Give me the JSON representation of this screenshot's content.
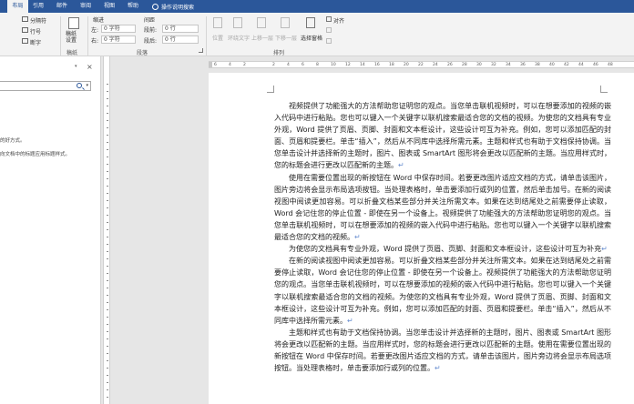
{
  "ribbon_tabs": [
    "布局",
    "引用",
    "邮件",
    "审阅",
    "视图",
    "帮助"
  ],
  "active_tab_index": 0,
  "tell_me": "操作说明搜索",
  "ribbon": {
    "breaks_label": "分隔符",
    "line_numbers_label": "行号",
    "hyphenation_label": "断字",
    "draft_label": "稿纸\n设置",
    "draft_group": "稿纸",
    "indent_label": "缩进",
    "spacing_label": "间距",
    "indent_left_label": "左:",
    "indent_left_value": "0 字符",
    "indent_right_label": "右:",
    "indent_right_value": "0 字符",
    "spacing_before_label": "段前:",
    "spacing_before_value": "0 行",
    "spacing_after_label": "段后:",
    "spacing_after_value": "0 行",
    "paragraph_group": "段落",
    "position_label": "位置",
    "wrap_label": "环绕文字",
    "forward_label": "上移一层",
    "backward_label": "下移一层",
    "selection_pane_label": "选择窗格",
    "align_label": "对齐",
    "arrange_group": "排列"
  },
  "nav": {
    "close": "×",
    "dropdown": "▾",
    "search_placeholder": "",
    "text1": "的好方式。",
    "text2": "向文档中的标题应用标题样式。"
  },
  "ruler_labels": [
    "6",
    "4",
    "2",
    "",
    "2",
    "4",
    "6",
    "8",
    "10",
    "12",
    "14",
    "16",
    "18",
    "20",
    "22",
    "24",
    "26",
    "28",
    "30",
    "32",
    "34",
    "36",
    "38",
    "40",
    "42",
    "44",
    "46",
    "48"
  ],
  "paragraphs": [
    "视频提供了功能强大的方法帮助您证明您的观点。当您单击联机视频时，可以在想要添加的视频的嵌入代码中进行粘贴。您也可以键入一个关键字以联机搜索最适合您的文档的视频。为使您的文档具有专业外观，Word 提供了页眉、页脚、封面和文本框设计，这些设计可互为补充。例如，您可以添加匹配的封面、页眉和提要栏。单击“插入”，然后从不同库中选择所需元素。主题和样式也有助于文档保持协调。当您单击设计并选择新的主题时，图片、图表或 SmartArt 图形将会更改以匹配新的主题。当应用样式时，您的标题会进行更改以匹配新的主题。",
    "使用在需要位置出现的新按钮在 Word 中保存时间。若要更改图片适应文档的方式，请单击该图片，图片旁边将会显示布局选项按钮。当处理表格时，单击要添加行或列的位置，然后单击加号。在新的阅读视图中阅读更加容易。可以折叠文档某些部分并关注所需文本。如果在达到结尾处之前需要停止读取，Word 会记住您的停止位置 - 即使在另一个设备上。视频提供了功能强大的方法帮助您证明您的观点。当您单击联机视频时，可以在想要添加的视频的嵌入代码中进行粘贴。您也可以键入一个关键字以联机搜索最适合您的文档的视频。",
    "为使您的文档具有专业外观，Word 提供了页眉、页脚、封面和文本框设计，这些设计可互为补充",
    "在新的阅读视图中阅读更加容易。可以折叠文档某些部分并关注所需文本。如果在达到结尾处之前需要停止读取，Word 会记住您的停止位置 - 即使在另一个设备上。视频提供了功能强大的方法帮助您证明您的观点。当您单击联机视频时，可以在想要添加的视频的嵌入代码中进行粘贴。您也可以键入一个关键字以联机搜索最适合您的文档的视频。为使您的文档具有专业外观，Word 提供了页眉、页脚、封面和文本框设计，这些设计可互为补充。例如，您可以添加匹配的封面、页眉和提要栏。单击“插入”，然后从不同库中选择所需元素。",
    "主题和样式也有助于文档保持协调。当您单击设计并选择新的主题时，图片、图表或 SmartArt 图形将会更改以匹配新的主题。当应用样式时，您的标题会进行更改以匹配新的主题。使用在需要位置出现的新按钮在 Word 中保存时间。若要更改图片适应文档的方式，请单击该图片，图片旁边将会显示布局选项按钮。当处理表格时，单击要添加行或列的位置。"
  ],
  "paragraph_mark": "↵",
  "colors": {
    "accent": "#2b579a",
    "ribbon": "#f3f3f3",
    "canvas": "#e6e6e6"
  }
}
